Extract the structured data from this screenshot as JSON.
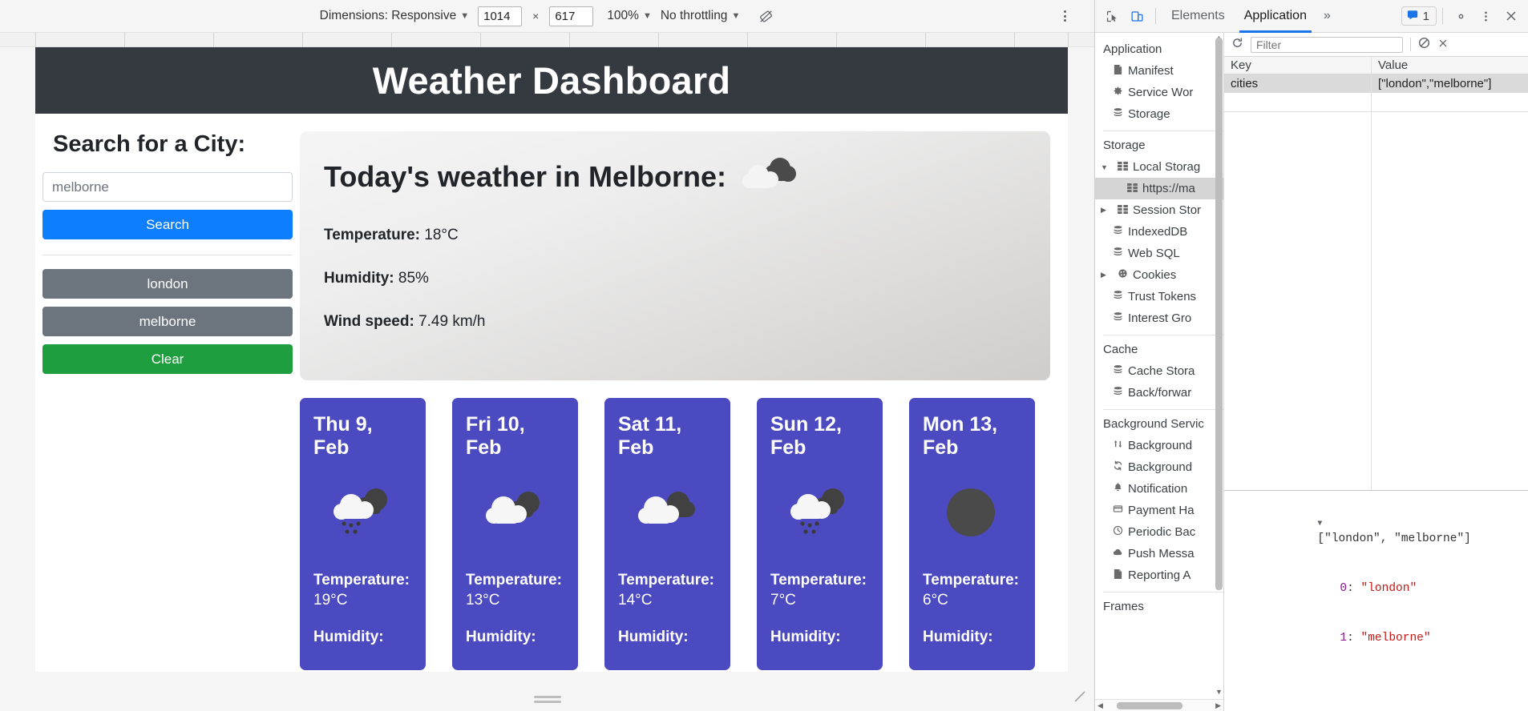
{
  "device_toolbar": {
    "dimensions_label": "Dimensions: Responsive",
    "width_value": "1014",
    "height_value": "617",
    "x_separator": "×",
    "zoom_label": "100%",
    "throttling_label": "No throttling",
    "rotate_icon": "rotate-device-icon",
    "more_icon": "kebab-menu-icon"
  },
  "app": {
    "title": "Weather Dashboard",
    "sidebar": {
      "heading": "Search for a City:",
      "input_value": "melborne",
      "input_placeholder": "melborne",
      "search_label": "Search",
      "history": [
        "london",
        "melborne"
      ],
      "clear_label": "Clear"
    },
    "today": {
      "heading": "Today's weather in Melborne:",
      "icon": "broken-clouds-icon",
      "temperature_label": "Temperature:",
      "temperature_value": "18°C",
      "humidity_label": "Humidity:",
      "humidity_value": "85%",
      "wind_label": "Wind speed:",
      "wind_value": "7.49 km/h"
    },
    "forecast": [
      {
        "date": "Thu 9, Feb",
        "icon": "rain-clouds-icon",
        "temp_label": "Temperature:",
        "temp": "19°C",
        "humidity_label": "Humidity:"
      },
      {
        "date": "Fri 10, Feb",
        "icon": "broken-clouds-icon",
        "temp_label": "Temperature:",
        "temp": "13°C",
        "humidity_label": "Humidity:"
      },
      {
        "date": "Sat 11, Feb",
        "icon": "broken-clouds-icon",
        "temp_label": "Temperature:",
        "temp": "14°C",
        "humidity_label": "Humidity:"
      },
      {
        "date": "Sun 12, Feb",
        "icon": "rain-clouds-icon",
        "temp_label": "Temperature:",
        "temp": "7°C",
        "humidity_label": "Humidity:"
      },
      {
        "date": "Mon 13, Feb",
        "icon": "overcast-circle-icon",
        "temp_label": "Temperature:",
        "temp": "6°C",
        "humidity_label": "Humidity:"
      }
    ],
    "colors": {
      "header_bg": "#343a40",
      "search_btn": "#0d7efd",
      "city_btn": "#6c757d",
      "clear_btn": "#1e9e3e",
      "forecast_card": "#4c4ac0"
    }
  },
  "devtools": {
    "inspect_icon": "inspect-element-icon",
    "device_toggle_icon": "device-toolbar-icon",
    "tabs": [
      {
        "label": "Elements",
        "active": false
      },
      {
        "label": "Application",
        "active": true
      }
    ],
    "more_tabs_icon": "chevron-double-right-icon",
    "issues_count": "1",
    "issues_icon": "message-badge-icon",
    "settings_icon": "gear-icon",
    "kebab_icon": "kebab-menu-icon",
    "close_icon": "close-icon",
    "tree": [
      {
        "title": "Application",
        "items": [
          {
            "label": "Manifest",
            "icon": "document-icon",
            "indent": 0,
            "arrow": "",
            "selected": false
          },
          {
            "label": "Service Wor",
            "icon": "gear-icon",
            "indent": 0,
            "arrow": "",
            "selected": false
          },
          {
            "label": "Storage",
            "icon": "database-icon",
            "indent": 0,
            "arrow": "",
            "selected": false
          }
        ]
      },
      {
        "title": "Storage",
        "items": [
          {
            "label": "Local Storag",
            "icon": "table-icon",
            "indent": 0,
            "arrow": "▼",
            "selected": false
          },
          {
            "label": "https://ma",
            "icon": "table-icon",
            "indent": 1,
            "arrow": "",
            "selected": true
          },
          {
            "label": "Session Stor",
            "icon": "table-icon",
            "indent": 0,
            "arrow": "▶",
            "selected": false
          },
          {
            "label": "IndexedDB",
            "icon": "database-icon",
            "indent": 0,
            "arrow": "",
            "selected": false
          },
          {
            "label": "Web SQL",
            "icon": "database-icon",
            "indent": 0,
            "arrow": "",
            "selected": false
          },
          {
            "label": "Cookies",
            "icon": "cookie-icon",
            "indent": 0,
            "arrow": "▶",
            "selected": false
          },
          {
            "label": "Trust Tokens",
            "icon": "database-icon",
            "indent": 0,
            "arrow": "",
            "selected": false
          },
          {
            "label": "Interest Gro",
            "icon": "database-icon",
            "indent": 0,
            "arrow": "",
            "selected": false
          }
        ]
      },
      {
        "title": "Cache",
        "items": [
          {
            "label": "Cache Stora",
            "icon": "database-icon",
            "indent": 0,
            "arrow": "",
            "selected": false
          },
          {
            "label": "Back/forwar",
            "icon": "database-icon",
            "indent": 0,
            "arrow": "",
            "selected": false
          }
        ]
      },
      {
        "title": "Background Servic",
        "items": [
          {
            "label": "Background",
            "icon": "updown-arrows-icon",
            "indent": 0,
            "arrow": "",
            "selected": false
          },
          {
            "label": "Background",
            "icon": "sync-icon",
            "indent": 0,
            "arrow": "",
            "selected": false
          },
          {
            "label": "Notification",
            "icon": "bell-icon",
            "indent": 0,
            "arrow": "",
            "selected": false
          },
          {
            "label": "Payment Ha",
            "icon": "credit-card-icon",
            "indent": 0,
            "arrow": "",
            "selected": false
          },
          {
            "label": "Periodic Bac",
            "icon": "clock-icon",
            "indent": 0,
            "arrow": "",
            "selected": false
          },
          {
            "label": "Push Messa",
            "icon": "cloud-icon",
            "indent": 0,
            "arrow": "",
            "selected": false
          },
          {
            "label": "Reporting A",
            "icon": "document-icon",
            "indent": 0,
            "arrow": "",
            "selected": false
          }
        ]
      },
      {
        "title": "Frames",
        "items": []
      }
    ],
    "storage": {
      "refresh_icon": "refresh-icon",
      "filter_placeholder": "Filter",
      "clear_all_icon": "clear-all-icon",
      "delete_icon": "delete-selected-icon",
      "columns": [
        "Key",
        "Value"
      ],
      "rows": [
        {
          "key": "cities",
          "value": "[\"london\",\"melborne\"]",
          "selected": true
        }
      ],
      "preview": {
        "root": "[\"london\", \"melborne\"]",
        "entries": [
          {
            "index": "0",
            "value": "\"london\""
          },
          {
            "index": "1",
            "value": "\"melborne\""
          }
        ]
      }
    }
  }
}
